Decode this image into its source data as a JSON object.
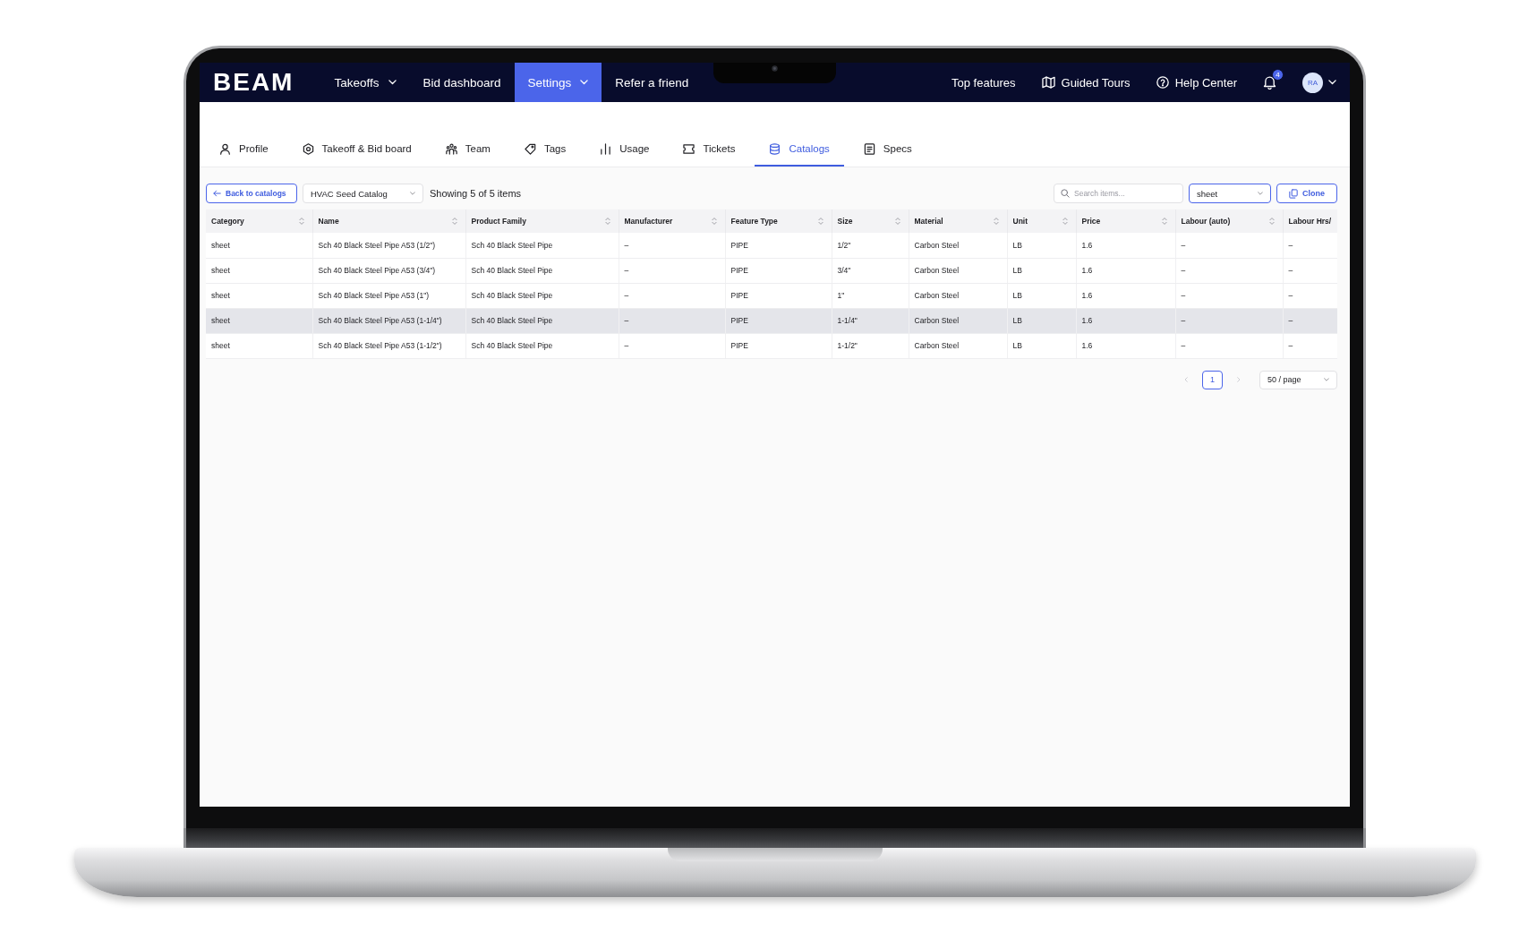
{
  "nav": {
    "logo": "BEAM",
    "items": [
      {
        "label": "Takeoffs",
        "kind": "menu",
        "selected": false
      },
      {
        "label": "Bid dashboard",
        "kind": "link",
        "selected": false
      },
      {
        "label": "Settings",
        "kind": "menu",
        "selected": true
      },
      {
        "label": "Refer a friend",
        "kind": "link",
        "selected": false
      }
    ],
    "links": [
      {
        "label": "Top features"
      },
      {
        "label": "Guided Tours"
      },
      {
        "label": "Help Center"
      }
    ],
    "notifications": {
      "count": "4"
    },
    "account": {
      "initials": "RA"
    }
  },
  "tabs": [
    {
      "label": "Profile",
      "selected": false
    },
    {
      "label": "Takeoff & Bid board",
      "selected": false
    },
    {
      "label": "Team",
      "selected": false
    },
    {
      "label": "Tags",
      "selected": false
    },
    {
      "label": "Usage",
      "selected": false
    },
    {
      "label": "Tickets",
      "selected": false
    },
    {
      "label": "Catalogs",
      "selected": true
    },
    {
      "label": "Specs",
      "selected": false
    }
  ],
  "toolbar": {
    "back_button": "Back to catalogs",
    "catalog_select": {
      "value": "HVAC Seed Catalog",
      "focused": false
    },
    "summary": "Showing 5 of 5 items",
    "search": {
      "placeholder": "Search items..."
    },
    "category_filter": {
      "value": "sheet",
      "focused": true
    },
    "clone_button": "Clone"
  },
  "table": {
    "columns": [
      {
        "label": "Category",
        "sortable": true
      },
      {
        "label": "Name",
        "sortable": true
      },
      {
        "label": "Product Family",
        "sortable": true
      },
      {
        "label": "Manufacturer",
        "sortable": true
      },
      {
        "label": "Feature Type",
        "sortable": true
      },
      {
        "label": "Size",
        "sortable": true
      },
      {
        "label": "Material",
        "sortable": true
      },
      {
        "label": "Unit",
        "sortable": true
      },
      {
        "label": "Price",
        "sortable": true
      },
      {
        "label": "Labour (auto)",
        "sortable": true
      },
      {
        "label": "Labour Hrs/",
        "sortable": false
      }
    ],
    "rows": [
      {
        "hovered": false,
        "cells": [
          "sheet",
          "Sch 40 Black Steel Pipe A53 (1/2\")",
          "Sch 40 Black Steel Pipe",
          "–",
          "PIPE",
          "1/2\"",
          "Carbon Steel",
          "LB",
          "1.6",
          "–",
          "–"
        ]
      },
      {
        "hovered": false,
        "cells": [
          "sheet",
          "Sch 40 Black Steel Pipe A53 (3/4\")",
          "Sch 40 Black Steel Pipe",
          "–",
          "PIPE",
          "3/4\"",
          "Carbon Steel",
          "LB",
          "1.6",
          "–",
          "–"
        ]
      },
      {
        "hovered": false,
        "cells": [
          "sheet",
          "Sch 40 Black Steel Pipe A53 (1\")",
          "Sch 40 Black Steel Pipe",
          "–",
          "PIPE",
          "1\"",
          "Carbon Steel",
          "LB",
          "1.6",
          "–",
          "–"
        ]
      },
      {
        "hovered": true,
        "cells": [
          "sheet",
          "Sch 40 Black Steel Pipe A53 (1-1/4\")",
          "Sch 40 Black Steel Pipe",
          "–",
          "PIPE",
          "1-1/4\"",
          "Carbon Steel",
          "LB",
          "1.6",
          "–",
          "–"
        ]
      },
      {
        "hovered": false,
        "cells": [
          "sheet",
          "Sch 40 Black Steel Pipe A53 (1-1/2\")",
          "Sch 40 Black Steel Pipe",
          "–",
          "PIPE",
          "1-1/2\"",
          "Carbon Steel",
          "LB",
          "1.6",
          "–",
          "–"
        ]
      }
    ]
  },
  "pagination": {
    "previous": {
      "disabled": true
    },
    "pages": [
      {
        "label": "1",
        "selected": true
      }
    ],
    "next": {
      "disabled": true
    },
    "page_size": "50 / page"
  }
}
